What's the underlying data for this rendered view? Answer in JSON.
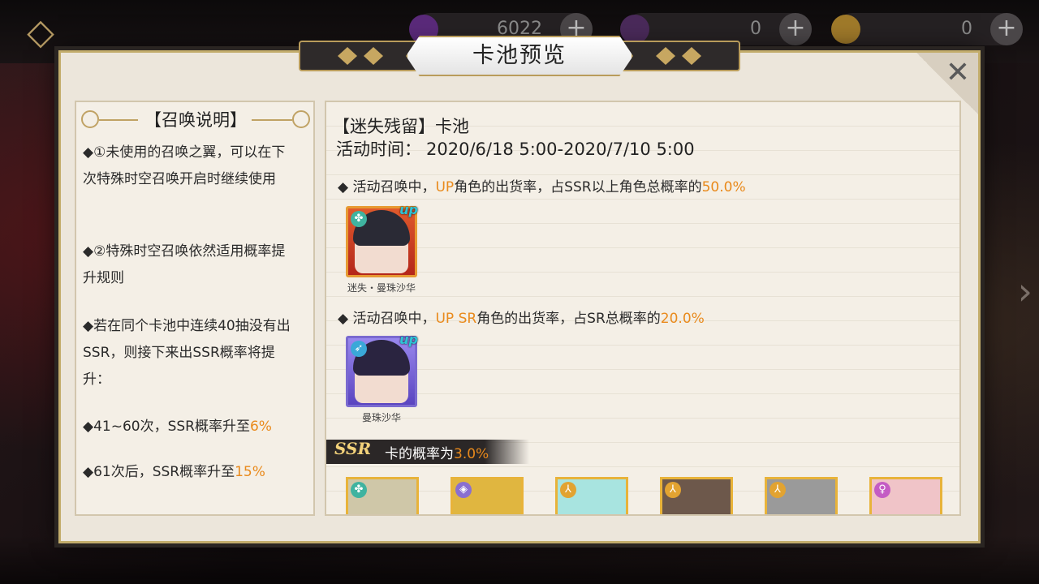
{
  "background": {
    "resources": [
      {
        "value": "6022",
        "color": "#5a2a7a"
      },
      {
        "value": "0",
        "color": "#4a2a5a"
      },
      {
        "value": "0",
        "color": "#a07a2a"
      }
    ]
  },
  "dialog": {
    "title": "卡池预览",
    "rules": {
      "header": "【召唤说明】",
      "items": [
        "◆①未使用的召唤之翼，可以在下次特殊时空召唤开启时继续使用",
        "◆②特殊时空召唤依然适用概率提升规则",
        "◆若在同个卡池中连续40抽没有出SSR，则接下来出SSR概率将提升：",
        {
          "prefix": "◆41~60次，SSR概率升至",
          "value": "6%"
        },
        {
          "prefix": "◆61次后，SSR概率升至",
          "value": "15%"
        }
      ]
    },
    "pool": {
      "name": "【迷失残留】卡池",
      "time_label": "活动时间：",
      "time_value": "2020/6/18  5:00-2020/7/10  5:00",
      "note1": {
        "pre": "◆   活动召唤中，",
        "hl": "UP",
        "mid": "角色的出货率，占SSR以上角色总概率的",
        "val": "50.0%"
      },
      "note2": {
        "pre": "◆   活动召唤中，",
        "hl": "UP  SR",
        "mid": "角色的出货率，占SR总概率的",
        "val": "20.0%"
      },
      "up_ssr": {
        "name": "迷失・曼珠沙华",
        "badge": "up",
        "icon": "clover-icon"
      },
      "up_sr": {
        "name": "曼珠沙华",
        "badge": "up",
        "icon": "bow-icon"
      },
      "ssr_rate": {
        "badge": "SSR",
        "label": "卡的概率为",
        "value": "3.0%"
      },
      "ssr_cards": [
        {
          "icon": "clover-icon",
          "icon_color": "#3fb3a0",
          "hair": "#cfc7a8"
        },
        {
          "icon": "shield-icon",
          "icon_color": "#8a6fd0",
          "hair": "#e0b640"
        },
        {
          "icon": "person-icon",
          "icon_color": "#e2a331",
          "hair": "#a8e4e0"
        },
        {
          "icon": "person-icon",
          "icon_color": "#e2a331",
          "hair": "#6d584b"
        },
        {
          "icon": "person-icon",
          "icon_color": "#e2a331",
          "hair": "#9a9a9a"
        },
        {
          "icon": "female-icon",
          "icon_color": "#c45cc4",
          "hair": "#f0c4c8"
        }
      ]
    }
  }
}
